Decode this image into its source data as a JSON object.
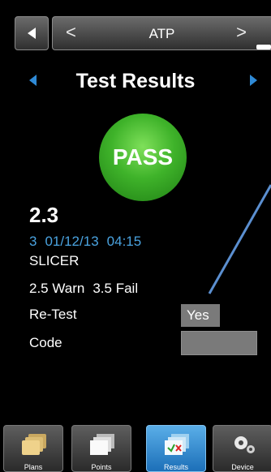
{
  "nav": {
    "title": "ATP",
    "prev_glyph": "<",
    "next_glyph": ">"
  },
  "header": {
    "title": "Test Results"
  },
  "result": {
    "status": "PASS",
    "value": "2.3",
    "meta": {
      "number": "3",
      "date": "01/12/13",
      "time": "04:15"
    },
    "point_name": "SLICER",
    "warn": "2.5 Warn",
    "fail": "3.5 Fail",
    "retest_label": "Re-Test",
    "retest_value": "Yes",
    "code_label": "Code",
    "code_value": ""
  },
  "tabs": [
    {
      "label": "Plans",
      "icon": "folders-icon"
    },
    {
      "label": "Points",
      "icon": "pages-icon"
    },
    {
      "label": "Results",
      "icon": "results-icon",
      "active": true
    },
    {
      "label": "Device",
      "icon": "gears-icon"
    }
  ],
  "colors": {
    "accent_blue": "#2f8ad6",
    "pass_green": "#3fb32a",
    "meta_blue": "#4aa3e0",
    "callout_line": "#5b8fd0"
  }
}
